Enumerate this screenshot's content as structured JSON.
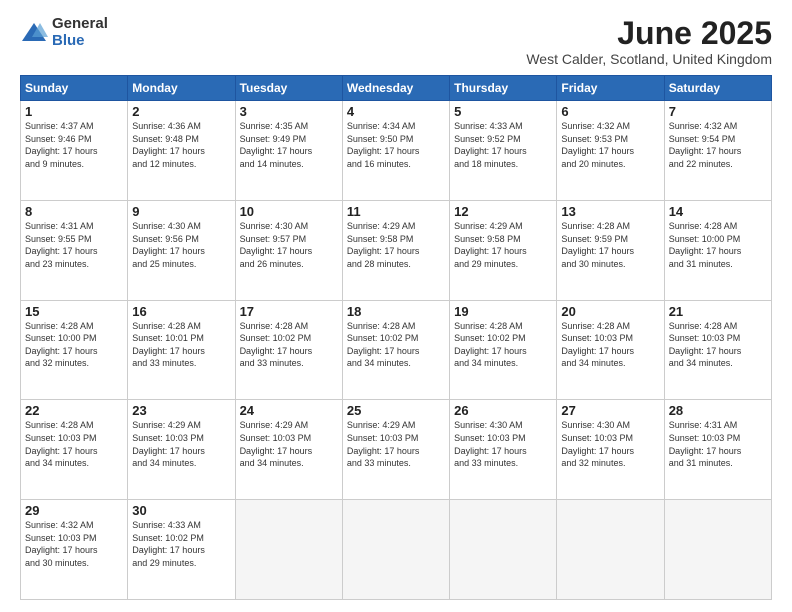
{
  "logo": {
    "general": "General",
    "blue": "Blue"
  },
  "title": "June 2025",
  "subtitle": "West Calder, Scotland, United Kingdom",
  "days_of_week": [
    "Sunday",
    "Monday",
    "Tuesday",
    "Wednesday",
    "Thursday",
    "Friday",
    "Saturday"
  ],
  "weeks": [
    [
      {
        "day": "1",
        "info": "Sunrise: 4:37 AM\nSunset: 9:46 PM\nDaylight: 17 hours\nand 9 minutes."
      },
      {
        "day": "2",
        "info": "Sunrise: 4:36 AM\nSunset: 9:48 PM\nDaylight: 17 hours\nand 12 minutes."
      },
      {
        "day": "3",
        "info": "Sunrise: 4:35 AM\nSunset: 9:49 PM\nDaylight: 17 hours\nand 14 minutes."
      },
      {
        "day": "4",
        "info": "Sunrise: 4:34 AM\nSunset: 9:50 PM\nDaylight: 17 hours\nand 16 minutes."
      },
      {
        "day": "5",
        "info": "Sunrise: 4:33 AM\nSunset: 9:52 PM\nDaylight: 17 hours\nand 18 minutes."
      },
      {
        "day": "6",
        "info": "Sunrise: 4:32 AM\nSunset: 9:53 PM\nDaylight: 17 hours\nand 20 minutes."
      },
      {
        "day": "7",
        "info": "Sunrise: 4:32 AM\nSunset: 9:54 PM\nDaylight: 17 hours\nand 22 minutes."
      }
    ],
    [
      {
        "day": "8",
        "info": "Sunrise: 4:31 AM\nSunset: 9:55 PM\nDaylight: 17 hours\nand 23 minutes."
      },
      {
        "day": "9",
        "info": "Sunrise: 4:30 AM\nSunset: 9:56 PM\nDaylight: 17 hours\nand 25 minutes."
      },
      {
        "day": "10",
        "info": "Sunrise: 4:30 AM\nSunset: 9:57 PM\nDaylight: 17 hours\nand 26 minutes."
      },
      {
        "day": "11",
        "info": "Sunrise: 4:29 AM\nSunset: 9:58 PM\nDaylight: 17 hours\nand 28 minutes."
      },
      {
        "day": "12",
        "info": "Sunrise: 4:29 AM\nSunset: 9:58 PM\nDaylight: 17 hours\nand 29 minutes."
      },
      {
        "day": "13",
        "info": "Sunrise: 4:28 AM\nSunset: 9:59 PM\nDaylight: 17 hours\nand 30 minutes."
      },
      {
        "day": "14",
        "info": "Sunrise: 4:28 AM\nSunset: 10:00 PM\nDaylight: 17 hours\nand 31 minutes."
      }
    ],
    [
      {
        "day": "15",
        "info": "Sunrise: 4:28 AM\nSunset: 10:00 PM\nDaylight: 17 hours\nand 32 minutes."
      },
      {
        "day": "16",
        "info": "Sunrise: 4:28 AM\nSunset: 10:01 PM\nDaylight: 17 hours\nand 33 minutes."
      },
      {
        "day": "17",
        "info": "Sunrise: 4:28 AM\nSunset: 10:02 PM\nDaylight: 17 hours\nand 33 minutes."
      },
      {
        "day": "18",
        "info": "Sunrise: 4:28 AM\nSunset: 10:02 PM\nDaylight: 17 hours\nand 34 minutes."
      },
      {
        "day": "19",
        "info": "Sunrise: 4:28 AM\nSunset: 10:02 PM\nDaylight: 17 hours\nand 34 minutes."
      },
      {
        "day": "20",
        "info": "Sunrise: 4:28 AM\nSunset: 10:03 PM\nDaylight: 17 hours\nand 34 minutes."
      },
      {
        "day": "21",
        "info": "Sunrise: 4:28 AM\nSunset: 10:03 PM\nDaylight: 17 hours\nand 34 minutes."
      }
    ],
    [
      {
        "day": "22",
        "info": "Sunrise: 4:28 AM\nSunset: 10:03 PM\nDaylight: 17 hours\nand 34 minutes."
      },
      {
        "day": "23",
        "info": "Sunrise: 4:29 AM\nSunset: 10:03 PM\nDaylight: 17 hours\nand 34 minutes."
      },
      {
        "day": "24",
        "info": "Sunrise: 4:29 AM\nSunset: 10:03 PM\nDaylight: 17 hours\nand 34 minutes."
      },
      {
        "day": "25",
        "info": "Sunrise: 4:29 AM\nSunset: 10:03 PM\nDaylight: 17 hours\nand 33 minutes."
      },
      {
        "day": "26",
        "info": "Sunrise: 4:30 AM\nSunset: 10:03 PM\nDaylight: 17 hours\nand 33 minutes."
      },
      {
        "day": "27",
        "info": "Sunrise: 4:30 AM\nSunset: 10:03 PM\nDaylight: 17 hours\nand 32 minutes."
      },
      {
        "day": "28",
        "info": "Sunrise: 4:31 AM\nSunset: 10:03 PM\nDaylight: 17 hours\nand 31 minutes."
      }
    ],
    [
      {
        "day": "29",
        "info": "Sunrise: 4:32 AM\nSunset: 10:03 PM\nDaylight: 17 hours\nand 30 minutes."
      },
      {
        "day": "30",
        "info": "Sunrise: 4:33 AM\nSunset: 10:02 PM\nDaylight: 17 hours\nand 29 minutes."
      },
      {
        "day": "",
        "info": ""
      },
      {
        "day": "",
        "info": ""
      },
      {
        "day": "",
        "info": ""
      },
      {
        "day": "",
        "info": ""
      },
      {
        "day": "",
        "info": ""
      }
    ]
  ]
}
